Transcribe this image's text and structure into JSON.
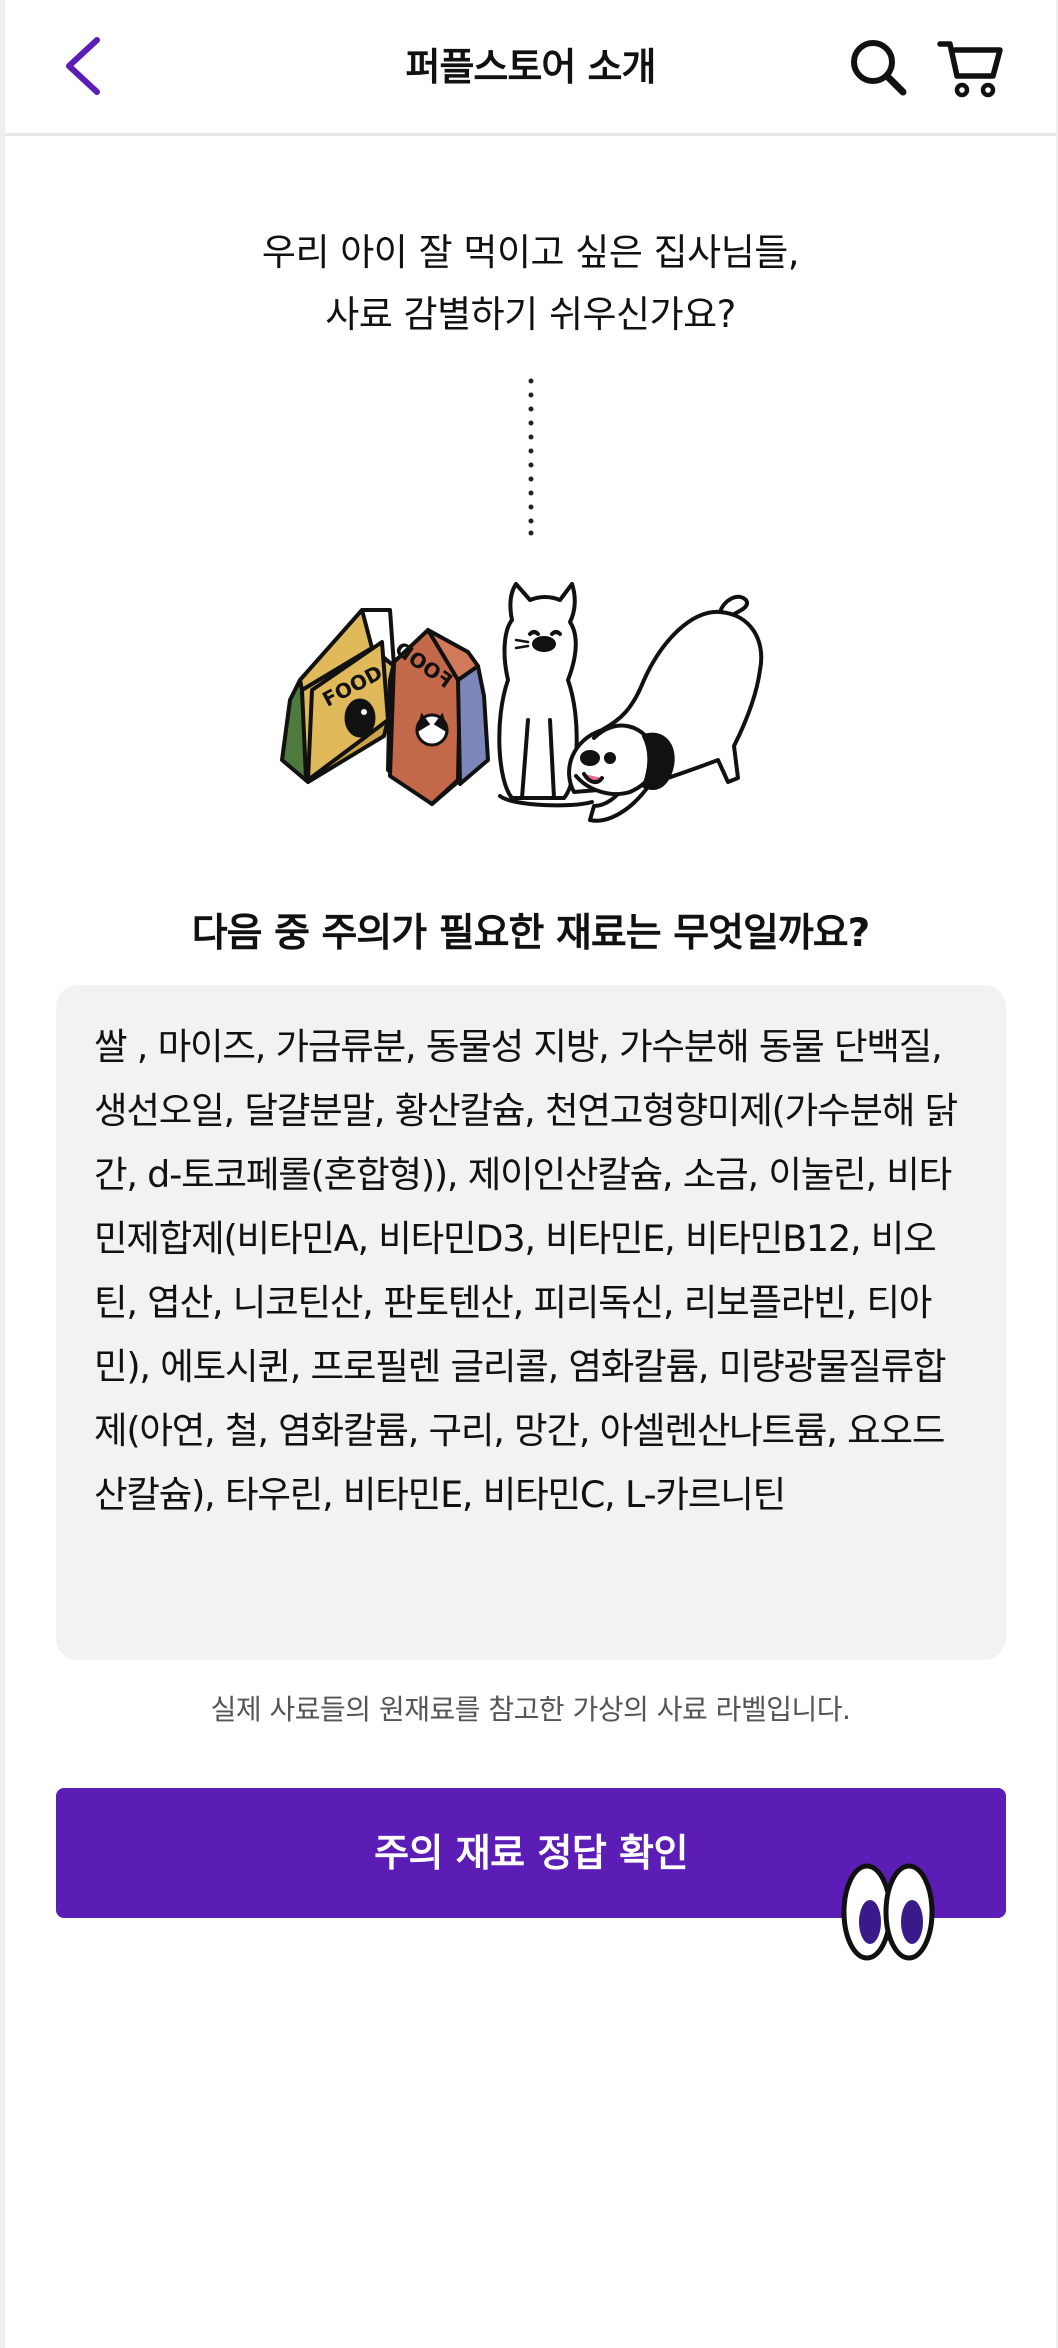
{
  "header": {
    "title": "퍼플스토어 소개",
    "back_icon": "chevron-left-icon",
    "search_icon": "search-icon",
    "cart_icon": "cart-icon"
  },
  "intro": {
    "line1": "우리 아이 잘 먹이고 싶은 집사님들,",
    "line2": "사료 감별하기 쉬우신가요?"
  },
  "illustration": {
    "bag1_label": "FOOD",
    "bag2_label": "FOOD"
  },
  "question": "다음 중 주의가 필요한 재료는 무엇일까요?",
  "ingredients": "쌀 , 마이즈, 가금류분, 동물성 지방, 가수분해 동물 단백질, 생선오일, 달걀분말, 황산칼슘, 천연고형향미제(가수분해 닭간, d-토코페롤(혼합형)), 제이인산칼슘, 소금, 이눌린, 비타민제합제(비타민A, 비타민D3, 비타민E, 비타민B12, 비오틴, 엽산, 니코틴산, 판토텐산, 피리독신, 리보플라빈, 티아민), 에토시퀸, 프로필렌 글리콜, 염화칼륨, 미량광물질류합제(아연, 철, 염화칼륨, 구리, 망간, 아셀렌산나트륨, 요오드산칼슘), 타우린, 비타민E, 비타민C, L-카르니틴",
  "note": "실제 사료들의 원재료를 참고한 가상의 사료 라벨입니다.",
  "answer_button": "주의 재료 정답 확인",
  "colors": {
    "accent": "#5b1db5",
    "box_bg": "#f2f2f2",
    "back_icon": "#5b1db5"
  }
}
